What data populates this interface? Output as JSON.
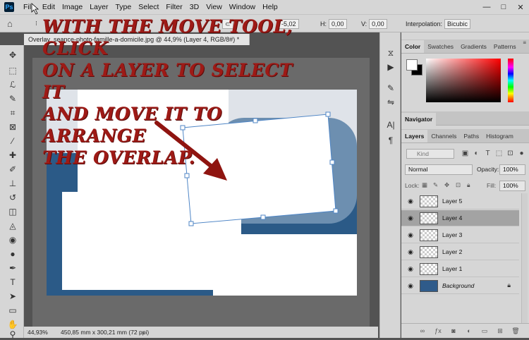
{
  "menubar": {
    "logo": "Ps",
    "items": [
      "File",
      "Edit",
      "Image",
      "Layer",
      "Type",
      "Select",
      "Filter",
      "3D",
      "View",
      "Window",
      "Help"
    ],
    "minimize": "—",
    "restore": "□",
    "close": "✕"
  },
  "options": {
    "h_label": "H:",
    "h_value": "0,00",
    "v_label": "V:",
    "v_value": "0,00",
    "angle_value": "-5,02",
    "interpolation_label": "Interpolation:",
    "interpolation_value": "Bicubic"
  },
  "document": {
    "tab_title": "Overlay_seance-photo-famille-a-domicile.jpg @ 44,9% (Layer 4, RGB/8#) *",
    "close": "×"
  },
  "annotation": {
    "line1": "With the move tool, click",
    "line2": "on a layer to select it",
    "line3": "and move it to arrange",
    "line4": "the overlap."
  },
  "status": {
    "zoom": "44,93%",
    "dimensions": "450,85 mm x 300,21 mm (72 ppi)",
    "arrow": "›"
  },
  "color_panel": {
    "tabs": [
      "Color",
      "Swatches",
      "Gradients",
      "Patterns"
    ],
    "foreground": "#ffffff",
    "background": "#000000"
  },
  "navigator": {
    "label": "Navigator"
  },
  "layers_panel": {
    "tabs": [
      "Layers",
      "Channels",
      "Paths",
      "Histogram"
    ],
    "kind_placeholder": "Kind",
    "blend_mode": "Normal",
    "opacity_label": "Opacity:",
    "opacity_value": "100%",
    "lock_label": "Lock:",
    "fill_label": "Fill:",
    "fill_value": "100%",
    "layers": [
      {
        "name": "Layer 5",
        "selected": false
      },
      {
        "name": "Layer 4",
        "selected": true
      },
      {
        "name": "Layer 3",
        "selected": false
      },
      {
        "name": "Layer 2",
        "selected": false
      },
      {
        "name": "Layer 1",
        "selected": false
      },
      {
        "name": "Background",
        "selected": false,
        "locked": true
      }
    ]
  },
  "colors": {
    "annotation": "#9e1a16",
    "ui_panel": "#d6d6d6",
    "selection": "#4f86c6"
  }
}
